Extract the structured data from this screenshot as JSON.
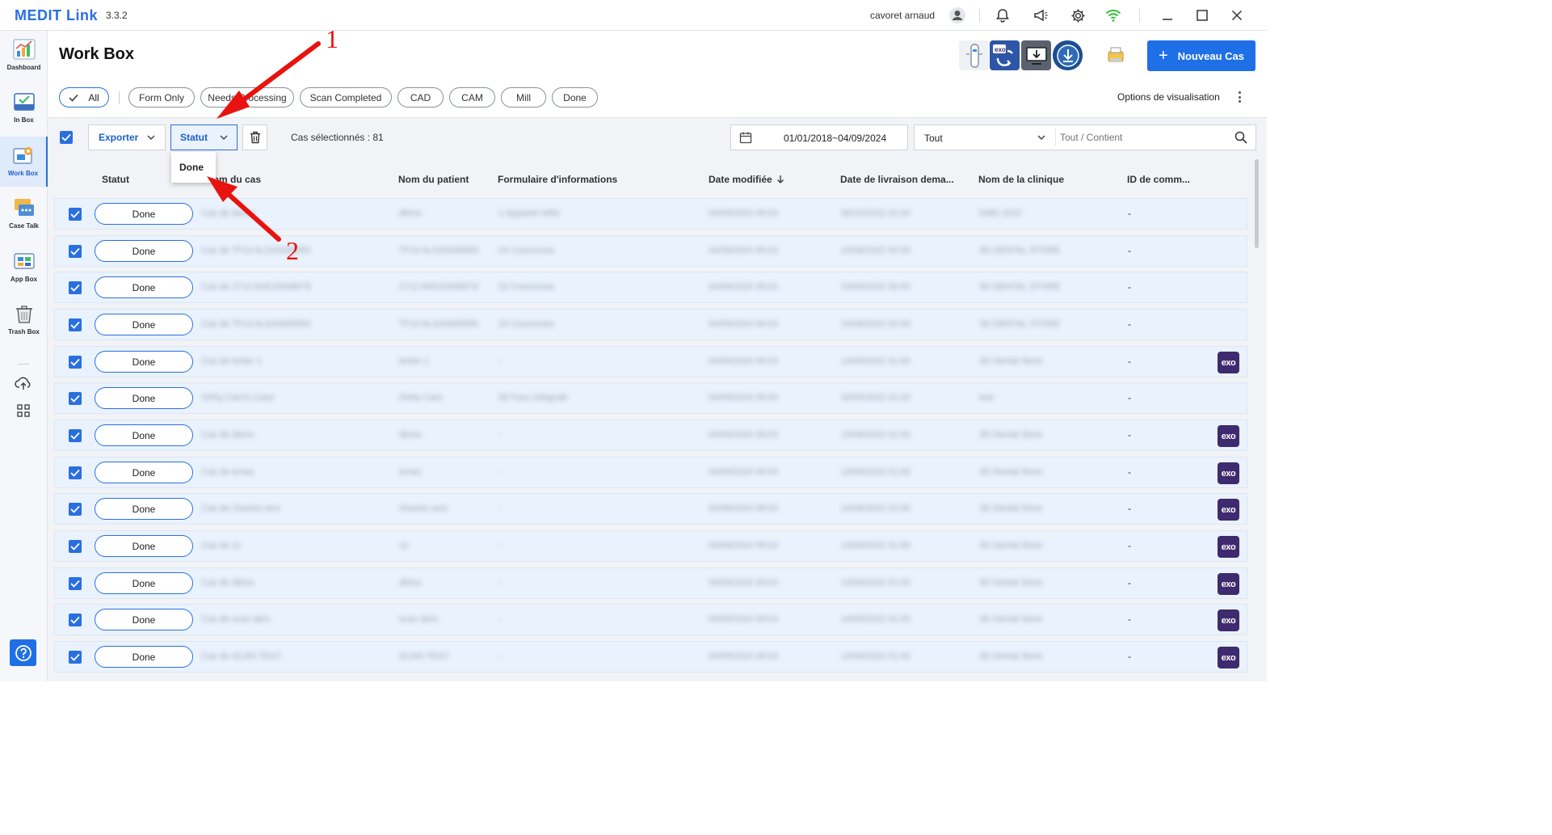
{
  "app": {
    "name": "MEDIT Link",
    "version": "3.3.2"
  },
  "titlebar": {
    "user": "cavoret arnaud"
  },
  "sidebar": {
    "items": [
      {
        "label": "Dashboard"
      },
      {
        "label": "In Box"
      },
      {
        "label": "Work Box"
      },
      {
        "label": "Case Talk"
      },
      {
        "label": "App Box"
      },
      {
        "label": "Trash Box"
      }
    ]
  },
  "header": {
    "title": "Work Box",
    "new_case": "Nouveau Cas"
  },
  "filters": {
    "chips": [
      "All",
      "Form Only",
      "Needs Processing",
      "Scan Completed",
      "CAD",
      "CAM",
      "Mill",
      "Done"
    ],
    "view_options": "Options de visualisation"
  },
  "toolbar": {
    "export": "Exporter",
    "status": "Statut",
    "selected_count": "Cas sélectionnés : 81",
    "date_range": "01/01/2018~04/09/2024",
    "search_scope": "Tout",
    "search_placeholder": "Tout / Contient"
  },
  "dropdown": {
    "option": "Done"
  },
  "table": {
    "columns": [
      "Statut",
      "Nom du cas",
      "Nom du patient",
      "Formulaire d'informations",
      "Date modifiée",
      "Date de livraison dema...",
      "Nom de la clinique",
      "ID de comm..."
    ],
    "rows": [
      {
        "status": "Done",
        "case": "Cas de demo",
        "patient": "démo",
        "form": "1 Appareil retfix",
        "modified": "04/09/2024 09:03",
        "delivery": "06/10/2022 01:00",
        "clinic": "DMD 2022",
        "order": "-",
        "exo": false
      },
      {
        "status": "Done",
        "case": "Cas de TF13 ALS20008065",
        "patient": "TF13 ALS20008065",
        "form": "24 Couronnes",
        "modified": "04/09/2024 09:03",
        "delivery": "24/06/2022 00:00",
        "clinic": "3D DENTAL STORE",
        "order": "-",
        "exo": false
      },
      {
        "status": "Done",
        "case": "Cas de 2712 AKE20008079",
        "patient": "2712 AKE20008079",
        "form": "22 Couronnes",
        "modified": "04/09/2024 09:03",
        "delivery": "24/06/2022 00:00",
        "clinic": "3D DENTAL STORE",
        "order": "-",
        "exo": false
      },
      {
        "status": "Done",
        "case": "Cas de TF13 ALS20008065",
        "patient": "TF13 ALS20008065",
        "form": "24 Couronnes",
        "modified": "04/09/2024 09:03",
        "delivery": "24/06/2022 00:00",
        "clinic": "3D DENTAL STORE",
        "order": "-",
        "exo": false
      },
      {
        "status": "Done",
        "case": "Cas de tester 1",
        "patient": "tester 1",
        "form": "-",
        "modified": "04/09/2024 09:03",
        "delivery": "14/06/2022 01:00",
        "clinic": "3D Dental Store",
        "order": "-",
        "exo": true
      },
      {
        "status": "Done",
        "case": "Orthy Caro's Case",
        "patient": "Orthy Caro",
        "form": "08 Faux Intégrale",
        "modified": "04/09/2024 09:03",
        "delivery": "03/05/2022 01:00",
        "clinic": "test",
        "order": "-",
        "exo": false
      },
      {
        "status": "Done",
        "case": "Cas de démo",
        "patient": "démo",
        "form": "-",
        "modified": "04/09/2024 09:03",
        "delivery": "14/06/2022 01:00",
        "clinic": "3D Dental Store",
        "order": "-",
        "exo": true
      },
      {
        "status": "Done",
        "case": "Cas de ernes",
        "patient": "ernes",
        "form": "-",
        "modified": "04/09/2024 09:03",
        "delivery": "14/06/2022 01:00",
        "clinic": "3D Dental Store",
        "order": "-",
        "exo": true
      },
      {
        "status": "Done",
        "case": "Cas de chassis sect",
        "patient": "chassis sect",
        "form": "-",
        "modified": "04/09/2024 09:03",
        "delivery": "14/06/2022 01:00",
        "clinic": "3D Dental Store",
        "order": "-",
        "exo": true
      },
      {
        "status": "Done",
        "case": "Cas de 11",
        "patient": "11",
        "form": "-",
        "modified": "04/09/2024 09:03",
        "delivery": "13/06/2022 01:00",
        "clinic": "3D Dental Store",
        "order": "-",
        "exo": true
      },
      {
        "status": "Done",
        "case": "Cas de démo",
        "patient": "démo",
        "form": "-",
        "modified": "04/09/2024 09:03",
        "delivery": "13/06/2022 01:00",
        "clinic": "3D Dental Store",
        "order": "-",
        "exo": true
      },
      {
        "status": "Done",
        "case": "Cas de scan dem",
        "patient": "scan dem",
        "form": "-",
        "modified": "04/09/2024 09:03",
        "delivery": "14/06/2022 01:00",
        "clinic": "3D Dental Store",
        "order": "-",
        "exo": true
      },
      {
        "status": "Done",
        "case": "Cas de SCAN TEST",
        "patient": "SCAN TEST",
        "form": "-",
        "modified": "04/09/2024 09:03",
        "delivery": "14/06/2022 01:00",
        "clinic": "3D Dental Store",
        "order": "-",
        "exo": true
      }
    ]
  },
  "annotations": {
    "first": "1",
    "second": "2"
  },
  "colors": {
    "accent": "#1f6fe6",
    "row_bg": "#e9f2fd",
    "exo": "#3e2a6e",
    "annotation": "#e8130e",
    "wifi": "#2fbf3a"
  }
}
